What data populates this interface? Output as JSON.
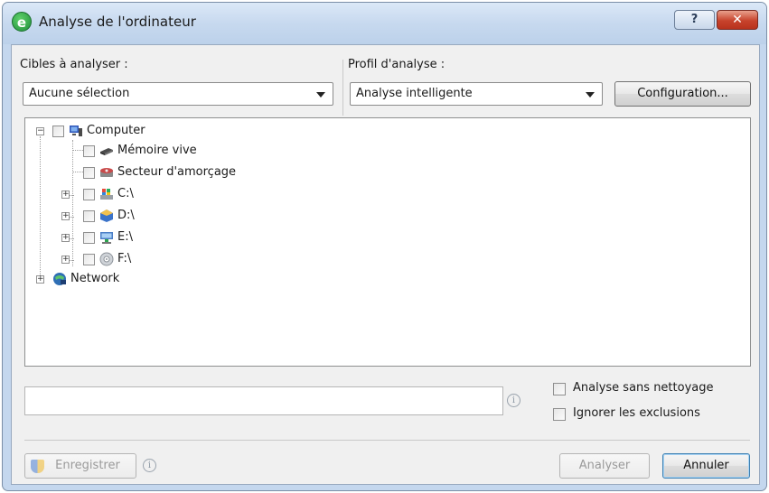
{
  "window": {
    "title": "Analyse de l'ordinateur",
    "app_icon_letter": "e",
    "help_glyph": "?",
    "close_glyph": "✕"
  },
  "targets": {
    "label": "Cibles à analyser :",
    "selected": "Aucune sélection"
  },
  "profile": {
    "label": "Profil d'analyse :",
    "selected": "Analyse intelligente",
    "config_button": "Configuration..."
  },
  "tree": {
    "root": {
      "label": "Computer",
      "icon": "computer-icon"
    },
    "items": [
      {
        "label": "Mémoire vive",
        "icon": "memory-icon"
      },
      {
        "label": "Secteur d'amorçage",
        "icon": "boot-sector-icon"
      },
      {
        "label": "C:\\",
        "icon": "drive-c-icon"
      },
      {
        "label": "D:\\",
        "icon": "drive-d-icon"
      },
      {
        "label": "E:\\",
        "icon": "drive-e-icon"
      },
      {
        "label": "F:\\",
        "icon": "drive-f-icon"
      }
    ],
    "network": {
      "label": "Network",
      "icon": "network-icon"
    }
  },
  "path_input": {
    "value": ""
  },
  "options": {
    "no_clean": "Analyse sans nettoyage",
    "ignore_exclusions": "Ignorer les exclusions"
  },
  "footer": {
    "save_button": "Enregistrer",
    "scan_button": "Analyser",
    "cancel_button": "Annuler"
  },
  "colors": {
    "title_bar": "#c7d9ef",
    "close_button": "#c7432c",
    "client_background": "#f0f0f0"
  }
}
